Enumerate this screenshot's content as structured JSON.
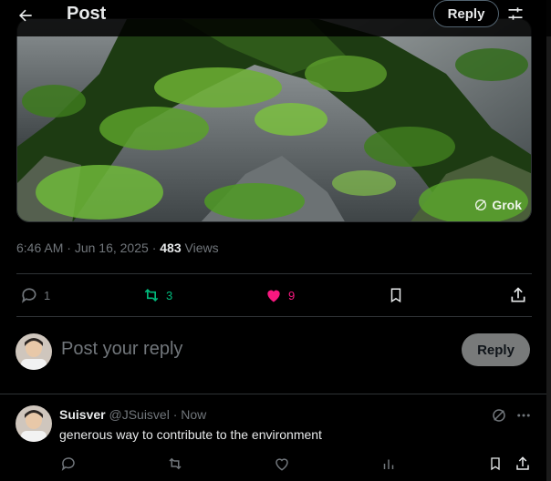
{
  "header": {
    "title": "Post",
    "reply_label": "Reply",
    "back_icon": "arrow-left-icon",
    "filter_icon": "sliders-icon"
  },
  "post": {
    "media_badge": "Grok",
    "time": "6:46 AM",
    "sep1": "·",
    "date": "Jun 16, 2025",
    "sep2": "·",
    "views_count": "483",
    "views_label": "Views",
    "actions": {
      "replies": "1",
      "reposts": "3",
      "likes": "9"
    }
  },
  "compose": {
    "placeholder": "Post your reply",
    "button_label": "Reply"
  },
  "reply": {
    "name": "Suisver",
    "handle": "@JSuisvel",
    "sep": "·",
    "time": "Now",
    "text": "generous way to contribute to the environment"
  },
  "colors": {
    "background": "#000000",
    "divider": "#2f3336",
    "muted": "#71767b",
    "repost_active": "#00ba7c",
    "like_active": "#f91880",
    "text": "#e7e9ea"
  }
}
